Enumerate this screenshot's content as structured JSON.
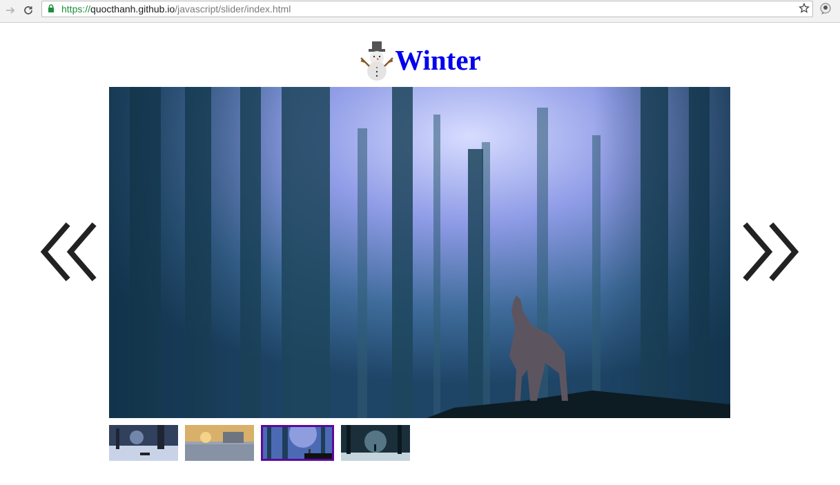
{
  "browser": {
    "url": {
      "scheme": "https://",
      "host": "quocthanh.github.io",
      "path": "/javascript/slider/index.html"
    },
    "icons": [
      "forward-icon",
      "reload-icon",
      "lock-icon",
      "bookmark-star-icon",
      "extension-icon"
    ]
  },
  "page": {
    "title": "Winter",
    "title_icon": "snowman-icon",
    "title_color": "#0000ee",
    "prev_label": "previous-arrow-icon",
    "next_label": "next-arrow-icon",
    "current_slide": 3,
    "slide_count": 4,
    "active_thumb_border": "#5a0a9e"
  }
}
